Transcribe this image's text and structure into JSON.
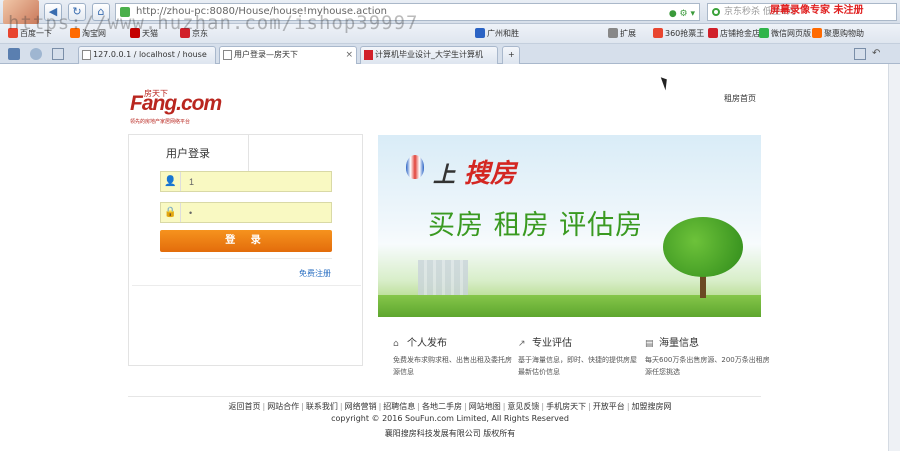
{
  "browser": {
    "url": "http://zhou-pc:8080/House/house!myhouse.action",
    "search_placeholder": "京东秒杀 低至1元",
    "recorder_label": "屏幕录像专家 未注册",
    "tabs": [
      {
        "label": "127.0.0.1 / localhost / house",
        "active": false
      },
      {
        "label": "用户登录—房天下",
        "active": true
      },
      {
        "label": "计算机毕业设计_大学生计算机",
        "active": false
      }
    ],
    "favorites": [
      {
        "label": "百度一下",
        "color": "#e8452f"
      },
      {
        "label": "淘宝网",
        "color": "#ff6a00"
      },
      {
        "label": "天猫",
        "color": "#c40000"
      },
      {
        "label": "京东",
        "color": "#d1202a"
      },
      {
        "label": "广州和胜",
        "color": "#2b63c4"
      }
    ],
    "favorites_right": [
      {
        "label": "扩展",
        "color": "#888888"
      },
      {
        "label": "360抢票王",
        "color": "#e8452f"
      },
      {
        "label": "店铺抢金店",
        "color": "#d1202a"
      },
      {
        "label": "微信网页版",
        "color": "#2fb44a"
      },
      {
        "label": "聚惠购物助",
        "color": "#ff6a00"
      }
    ]
  },
  "watermark": "https://www.huzhan.com/ishop39997",
  "page": {
    "logo_small": "房天下",
    "logo": "Fang.com",
    "logo_tagline": "领先的房地产家居网络平台",
    "top_link": "租房首页",
    "login": {
      "title": "用户登录",
      "username_value": "1",
      "password_value": "•",
      "submit_label": "登 录",
      "register_link": "免费注册"
    },
    "banner": {
      "prefix": "上",
      "brand": "搜房",
      "slogan": "买房 租房 评估房"
    },
    "features": [
      {
        "icon": "⌂",
        "title": "个人发布",
        "desc": "免费发布求购求租、出售出租及委托房源信息"
      },
      {
        "icon": "↗",
        "title": "专业评估",
        "desc": "基于海量信息，即时、快捷的提供房屋最新估价信息"
      },
      {
        "icon": "▤",
        "title": "海量信息",
        "desc": "每天600万条出售房源、200万条出租房源任您挑选"
      }
    ],
    "footer": {
      "links": [
        "返回首页",
        "网站合作",
        "联系我们",
        "网络营销",
        "招聘信息",
        "各地二手房",
        "网站地图",
        "意见反馈",
        "手机房天下",
        "开放平台",
        "加盟搜房网"
      ],
      "copyright": "copyright © 2016 SouFun.com Limited, All Rights Reserved",
      "company": "襄阳搜房科技发展有限公司 版权所有"
    }
  }
}
